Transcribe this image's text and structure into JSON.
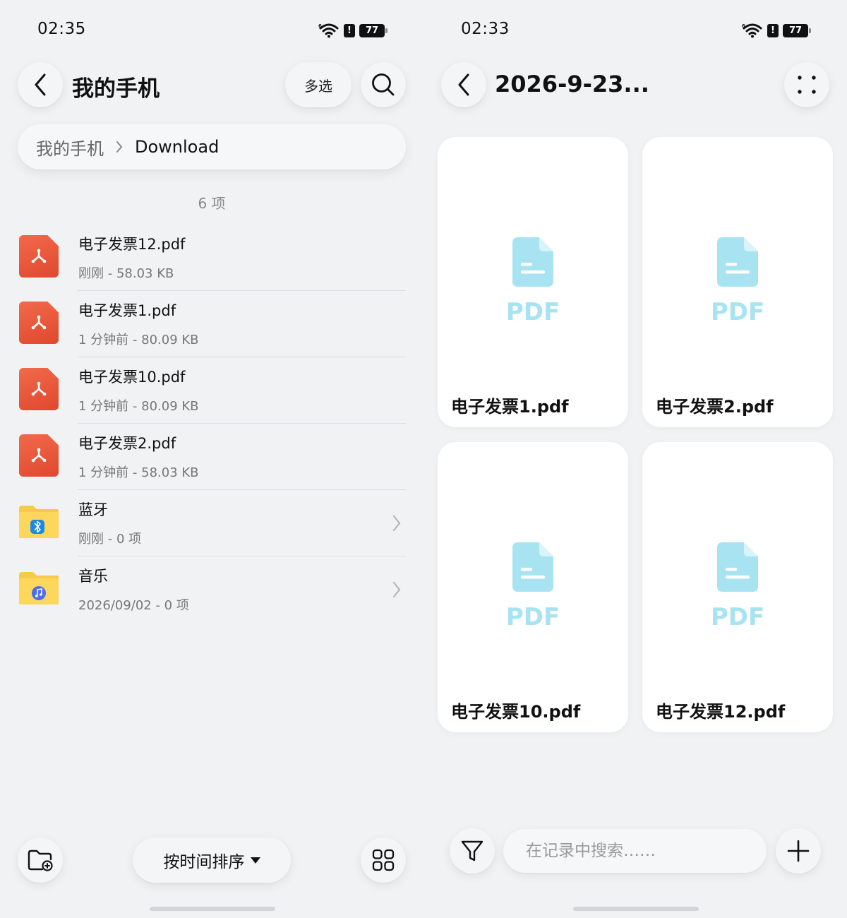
{
  "left": {
    "status": {
      "time": "02:35",
      "battery": "77"
    },
    "header": {
      "title": "我的手机",
      "multiselect_label": "多选"
    },
    "breadcrumb": {
      "root": "我的手机",
      "current": "Download"
    },
    "count": "6 项",
    "files": [
      {
        "name": "电子发票12.pdf",
        "meta": "刚刚 - 58.03 KB",
        "type": "pdf"
      },
      {
        "name": "电子发票1.pdf",
        "meta": "1 分钟前 - 80.09 KB",
        "type": "pdf"
      },
      {
        "name": "电子发票10.pdf",
        "meta": "1 分钟前 - 80.09 KB",
        "type": "pdf"
      },
      {
        "name": "电子发票2.pdf",
        "meta": "1 分钟前 - 58.03 KB",
        "type": "pdf"
      },
      {
        "name": "蓝牙",
        "meta": "刚刚 - 0 项",
        "type": "folder",
        "icon": "bluetooth-icon"
      },
      {
        "name": "音乐",
        "meta": "2026/09/02 - 0 项",
        "type": "folder",
        "icon": "music-icon"
      }
    ],
    "bottom": {
      "sort_label": "按时间排序"
    }
  },
  "right": {
    "status": {
      "time": "02:33",
      "battery": "77"
    },
    "header": {
      "title": "2026-9-23..."
    },
    "cards": [
      {
        "name": "电子发票1.pdf",
        "badge": "PDF"
      },
      {
        "name": "电子发票2.pdf",
        "badge": "PDF"
      },
      {
        "name": "电子发票10.pdf",
        "badge": "PDF"
      },
      {
        "name": "电子发票12.pdf",
        "badge": "PDF"
      }
    ],
    "bottom": {
      "search_placeholder": "在记录中搜索……"
    }
  },
  "colors": {
    "pdf_red": "#e9553a",
    "folder_yellow": "#fcd34d",
    "pdf_thumb_blue": "#a8e3f2"
  }
}
